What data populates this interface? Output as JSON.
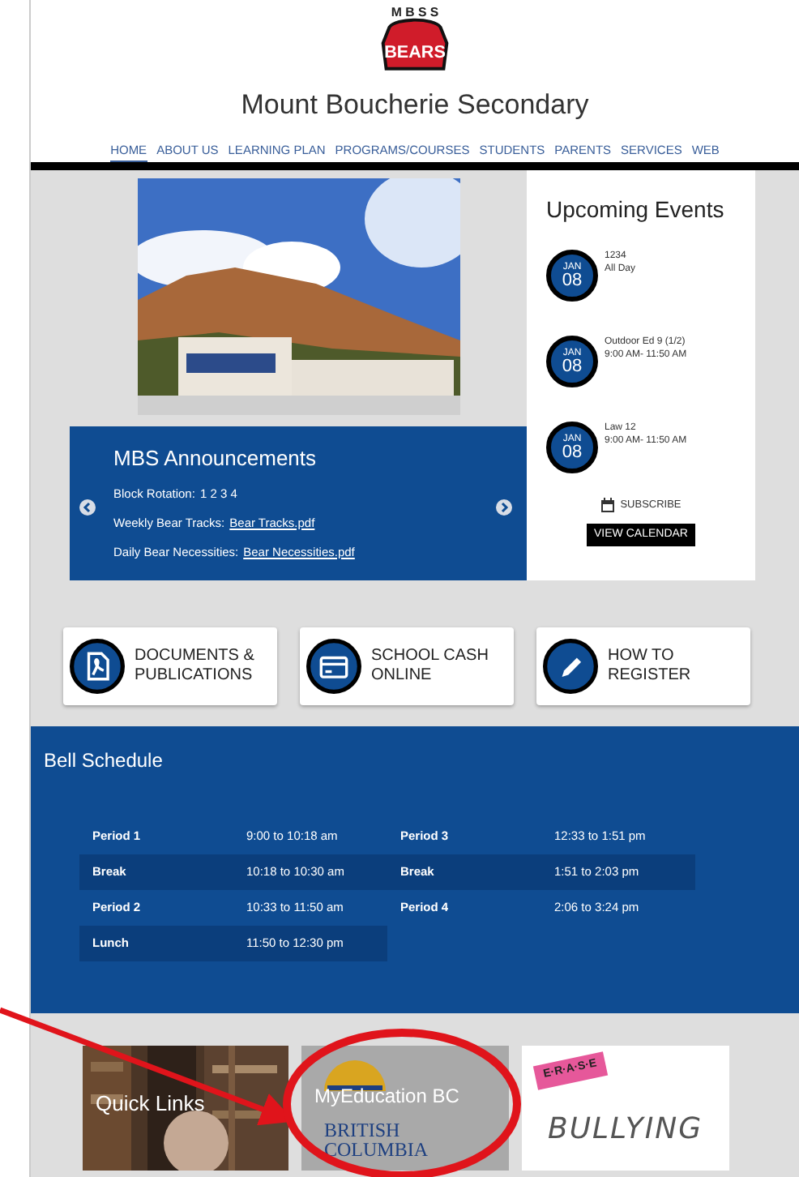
{
  "header": {
    "logo_letters": "M B S S",
    "logo_wordmark": "BEARS",
    "title": "Mount Boucherie Secondary"
  },
  "nav": [
    {
      "label": "HOME",
      "selected": true
    },
    {
      "label": "ABOUT US",
      "selected": false
    },
    {
      "label": "LEARNING PLAN",
      "selected": false
    },
    {
      "label": "PROGRAMS/COURSES",
      "selected": false
    },
    {
      "label": "STUDENTS",
      "selected": false
    },
    {
      "label": "PARENTS",
      "selected": false
    },
    {
      "label": "SERVICES",
      "selected": false
    },
    {
      "label": "WEB",
      "selected": false
    }
  ],
  "announcements": {
    "title": "MBS Announcements",
    "items": [
      {
        "label": "Block Rotation:",
        "value": "1 2 3 4"
      },
      {
        "label": "Weekly Bear Tracks:",
        "link": "Bear Tracks.pdf"
      },
      {
        "label": "Daily Bear Necessities:",
        "link": "Bear Necessities.pdf"
      }
    ]
  },
  "events": {
    "title": "Upcoming Events",
    "items": [
      {
        "month": "JAN",
        "day": "08",
        "name": "1234",
        "time": "All Day"
      },
      {
        "month": "JAN",
        "day": "08",
        "name": "Outdoor Ed 9 (1/2)",
        "time": "9:00 AM- 11:50 AM"
      },
      {
        "month": "JAN",
        "day": "08",
        "name": "Law 12",
        "time": "9:00 AM- 11:50 AM"
      }
    ],
    "subscribe": "SUBSCRIBE",
    "calendar_button": "VIEW CALENDAR"
  },
  "quick_buttons": [
    {
      "kind": "document",
      "label": "DOCUMENTS & PUBLICATIONS"
    },
    {
      "kind": "card",
      "label": "SCHOOL CASH ONLINE"
    },
    {
      "kind": "pencil",
      "label": "HOW TO REGISTER"
    }
  ],
  "bell_schedule": {
    "title": "Bell Schedule",
    "rows": [
      {
        "shaded": false,
        "cells": [
          "Period 1",
          "9:00 to 10:18 am",
          "Period 3",
          "12:33  to 1:51 pm"
        ]
      },
      {
        "shaded": true,
        "cells": [
          "Break",
          "10:18  to 10:30 am",
          "Break",
          "1:51 to 2:03 pm"
        ]
      },
      {
        "shaded": false,
        "cells": [
          "Period 2",
          "10:33  to 11:50 am",
          "Period 4",
          "2:06  to 3:24 pm"
        ]
      },
      {
        "shaded": true,
        "cells": [
          "Lunch",
          "11:50 to 12:30 pm"
        ]
      }
    ]
  },
  "tiles": [
    {
      "label": "Quick Links"
    },
    {
      "kind": "bc",
      "label": "MyEducation BC",
      "logo_lines": [
        "BRITISH",
        "COLUMBIA"
      ]
    },
    {
      "kind": "erase",
      "logo_lines": [
        "E·R·A·S·E",
        "BULLYING"
      ]
    }
  ]
}
